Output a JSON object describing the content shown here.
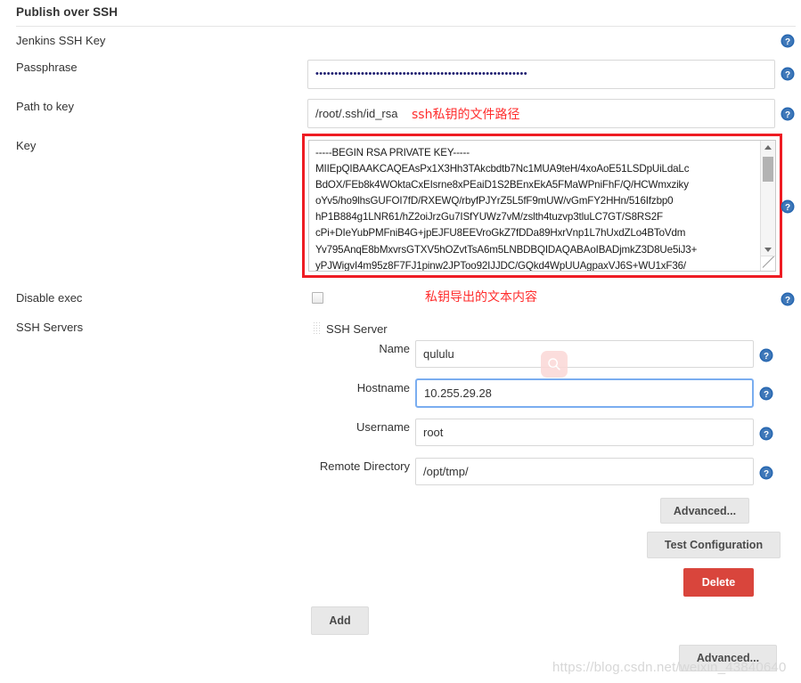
{
  "section": {
    "title": "Publish over SSH"
  },
  "fields": {
    "jenkins_ssh_key_label": "Jenkins SSH Key",
    "passphrase_label": "Passphrase",
    "passphrase_value": "••••••••••••••••••••••••••••••••••••••••••••••••••••••••",
    "path_to_key_label": "Path to key",
    "path_to_key_value": "/root/.ssh/id_rsa",
    "key_label": "Key",
    "key_value": "-----BEGIN RSA PRIVATE KEY-----\nMIIEpQIBAAKCAQEAsPx1X3Hh3TAkcbdtb7Nc1MUA9teH/4xoAoE51LSDpUiLdaLc\nBdOX/FEb8k4WOktaCxEIsrne8xPEaiD1S2BEnxEkA5FMaWPniFhF/Q/HCWmxziky\noYv5/ho9lhsGUFOI7fD/RXEWQ/rbyfPJYrZ5L5fF9mUW/vGmFY2HHn/516Ifzbp0\nhP1B884g1LNR61/hZ2oiJrzGu7ISfYUWz7vM/zslth4tuzvp3tluLC7GT/S8RS2F\ncPi+DIeYubPMFniB4G+jpEJFU8EEVroGkZ7fDDa89HxrVnp1L7hUxdZLo4BToVdm\nYv795AnqE8bMxvrsGTXV5hOZvtTsA6m5LNBDBQIDAQABAoIBADjmkZ3D8Ue5iJ3+\nyPJWigvI4m95z8F7FJ1pinw2JPToo92IJJDC/GQkd4WpUUAgpaxVJ6S+WU1xF36/",
    "disable_exec_label": "Disable exec",
    "ssh_servers_label": "SSH Servers"
  },
  "annotations": {
    "path_note": "ssh私钥的文件路径",
    "key_note": "私钥导出的文本内容"
  },
  "ssh_server": {
    "block_title": "SSH Server",
    "name_label": "Name",
    "name_value": "qululu",
    "hostname_label": "Hostname",
    "hostname_value": "10.255.29.28",
    "username_label": "Username",
    "username_value": "root",
    "remote_directory_label": "Remote Directory",
    "remote_directory_value": "/opt/tmp/"
  },
  "buttons": {
    "advanced_server": "Advanced...",
    "test_configuration": "Test Configuration",
    "delete": "Delete",
    "add": "Add",
    "advanced_section": "Advanced..."
  },
  "icons": {
    "help": "?",
    "search": "search-icon",
    "drag": "drag-handle-icon"
  },
  "colors": {
    "annotation_red": "#ff2d2d",
    "box_red": "#ee1c23",
    "delete_red": "#d9453c",
    "help_blue": "#2566b0",
    "focus_blue": "#7aadf0"
  },
  "watermark": {
    "text": "https://blog.csdn.net/weixin_43840640"
  }
}
